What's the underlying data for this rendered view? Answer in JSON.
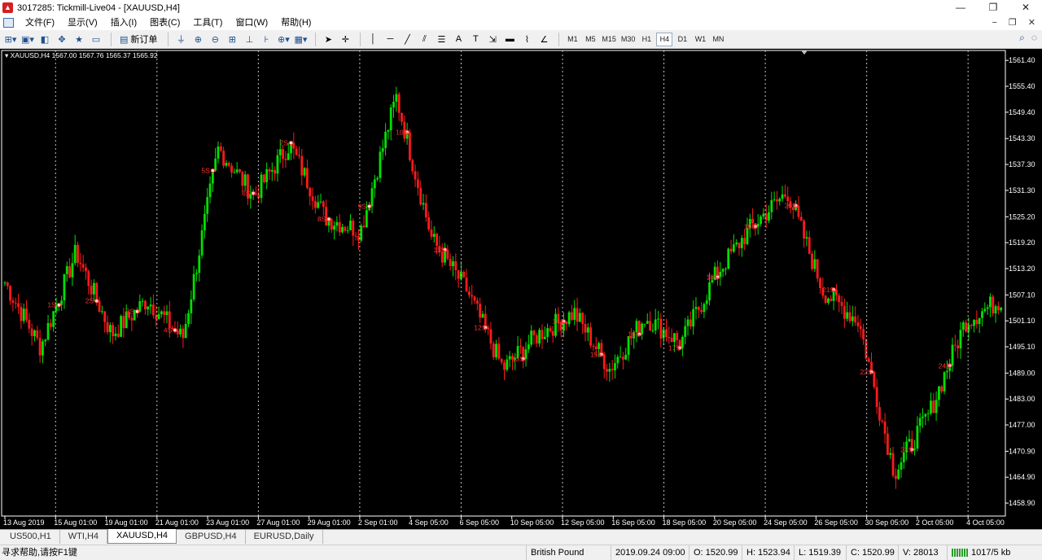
{
  "window": {
    "title": "3017285: Tickmill-Live04 - [XAUUSD,H4]",
    "min": "—",
    "max": "❐",
    "close": "✕"
  },
  "menu": {
    "items": [
      "文件(F)",
      "显示(V)",
      "插入(I)",
      "图表(C)",
      "工具(T)",
      "窗口(W)",
      "帮助(H)"
    ],
    "mdi": [
      "−",
      "❐",
      "✕"
    ]
  },
  "toolbar": {
    "new_order_label": "新订单",
    "timeframes": [
      "M1",
      "M5",
      "M15",
      "M30",
      "H1",
      "H4",
      "D1",
      "W1",
      "MN"
    ],
    "active_timeframe": "H4"
  },
  "colors": {
    "bull": "#00e000",
    "bear": "#ff1a1a",
    "grid": "#c0c0c0",
    "axis_text": "#ffffff",
    "label": "#ff3030"
  },
  "chart_data": {
    "type": "candlestick",
    "symbol_label": "XAUUSD,H4",
    "ohlc_label": "1567.00 1567.76 1565.37 1565.92",
    "ylim": [
      1455.9,
      1563.7
    ],
    "y_ticks": [
      1561.4,
      1555.4,
      1549.4,
      1543.3,
      1537.3,
      1531.3,
      1525.2,
      1519.2,
      1513.2,
      1507.1,
      1501.1,
      1495.1,
      1489.0,
      1483.0,
      1477.0,
      1470.9,
      1464.9,
      1458.9
    ],
    "y_tick_labels": [
      "1561.40",
      "1555.40",
      "1549.40",
      "1543.30",
      "1537.30",
      "1531.30",
      "1525.20",
      "1519.20",
      "1513.20",
      "1507.10",
      "1501.10",
      "1495.10",
      "1489.00",
      "1483.00",
      "1477.00",
      "1470.90",
      "1464.90",
      "1458.90"
    ],
    "x_tick_labels": [
      "13 Aug 2019",
      "15 Aug 01:00",
      "19 Aug 01:00",
      "21 Aug 01:00",
      "23 Aug 01:00",
      "27 Aug 01:00",
      "29 Aug 01:00",
      "2 Sep 01:00",
      "4 Sep 05:00",
      "6 Sep 05:00",
      "10 Sep 05:00",
      "12 Sep 05:00",
      "16 Sep 05:00",
      "18 Sep 05:00",
      "20 Sep 05:00",
      "24 Sep 05:00",
      "26 Sep 05:00",
      "30 Sep 05:00",
      "2 Oct 05:00",
      "4 Oct 05:00"
    ],
    "grid": "vertical-dotted",
    "trade_labels": [
      "1S",
      "2S",
      "3S",
      "4S",
      "5S",
      "6S",
      "7S",
      "8S",
      "9S",
      "10S",
      "11S",
      "12S",
      "13S",
      "14S",
      "15S",
      "16S",
      "17S",
      "18S",
      "19S",
      "20S",
      "21S",
      "22S",
      "23S",
      "24S"
    ],
    "key_points": [
      {
        "t": "13 Aug",
        "price": 1510
      },
      {
        "t": "14 Aug",
        "price": 1495
      },
      {
        "t": "15 Aug",
        "price": 1517
      },
      {
        "t": "19 Aug",
        "price": 1498
      },
      {
        "t": "21 Aug",
        "price": 1506
      },
      {
        "t": "23 Aug",
        "price": 1497
      },
      {
        "t": "26 Aug",
        "price": 1541
      },
      {
        "t": "27 Aug",
        "price": 1530
      },
      {
        "t": "28 Aug",
        "price": 1542
      },
      {
        "t": "29 Aug",
        "price": 1525
      },
      {
        "t": "2 Sep",
        "price": 1522
      },
      {
        "t": "4 Sep",
        "price": 1553
      },
      {
        "t": "5 Sep",
        "price": 1520
      },
      {
        "t": "6 Sep",
        "price": 1508
      },
      {
        "t": "10 Sep",
        "price": 1490
      },
      {
        "t": "11 Sep",
        "price": 1498
      },
      {
        "t": "12 Sep",
        "price": 1503
      },
      {
        "t": "13 Sep",
        "price": 1490
      },
      {
        "t": "16 Sep",
        "price": 1502
      },
      {
        "t": "18 Sep",
        "price": 1496
      },
      {
        "t": "20 Sep",
        "price": 1512
      },
      {
        "t": "23 Sep",
        "price": 1523
      },
      {
        "t": "24 Sep",
        "price": 1531
      },
      {
        "t": "25 Sep",
        "price": 1508
      },
      {
        "t": "26 Sep",
        "price": 1501
      },
      {
        "t": "30 Sep",
        "price": 1466
      },
      {
        "t": "1 Oct",
        "price": 1480
      },
      {
        "t": "2 Oct",
        "price": 1501
      },
      {
        "t": "4 Oct",
        "price": 1506
      }
    ]
  },
  "tabs": [
    "US500,H1",
    "WTI,H4",
    "XAUUSD,H4",
    "GBPUSD,H4",
    "EURUSD,Daily"
  ],
  "active_tab": "XAUUSD,H4",
  "status": {
    "help": "寻求帮助,请按F1键",
    "profile": "British Pound",
    "datetime": "2019.09.24 09:00",
    "open": "O: 1520.99",
    "high": "H: 1523.94",
    "low": "L: 1519.39",
    "close": "C: 1520.99",
    "volume": "V: 28013",
    "traffic": "1017/5 kb"
  }
}
